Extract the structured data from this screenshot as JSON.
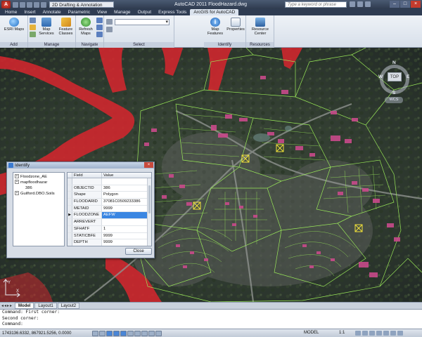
{
  "titlebar": {
    "app_letter": "A",
    "workspace": "2D Drafting & Annotation",
    "window_title": "AutoCAD 2011   FloodHazard.dwg",
    "search_placeholder": "Type a keyword or phrase"
  },
  "ribbon_tabs": [
    "Home",
    "Insert",
    "Annotate",
    "Parametric",
    "View",
    "Manage",
    "Output",
    "Express Tools",
    "ArcGIS for AutoCAD"
  ],
  "active_tab_index": 8,
  "ribbon": {
    "panels": {
      "add": "Add",
      "manage": "Manage",
      "navigate": "Navigate",
      "select": "Select",
      "identify": "Identify",
      "resources": "Resources"
    },
    "buttons": {
      "esri_maps": "ESRI Maps",
      "map_services": "Map Services",
      "feature_classes": "Feature Classes",
      "refresh_maps": "Refresh Maps",
      "map_features": "Map Features",
      "properties": "Properties",
      "resource_center": "Resource Center"
    }
  },
  "viewcube": {
    "north": "N",
    "south": "S",
    "east": "E",
    "west": "W",
    "top": "TOP",
    "wcs": "WCS"
  },
  "identify_dialog": {
    "title": "Identify",
    "tree": [
      {
        "label": "Floodzone_AE",
        "level": 0
      },
      {
        "label": "mapfloodhazar",
        "level": 0
      },
      {
        "label": "386",
        "level": 2
      },
      {
        "label": "Guilford.DBO.Soils",
        "level": 0
      }
    ],
    "columns": {
      "field": "Field",
      "value": "Value"
    },
    "rows": [
      {
        "field": "",
        "value": ""
      },
      {
        "field": "OBJECTID",
        "value": "386"
      },
      {
        "field": "Shape",
        "value": "Polygon"
      },
      {
        "field": "FLOODARID",
        "value": "37081C0509233386"
      },
      {
        "field": "METAID",
        "value": "9999"
      },
      {
        "field": "FLOODZONE",
        "value": "AEFW"
      },
      {
        "field": "ARREVERT",
        "value": ""
      },
      {
        "field": "SFHATF",
        "value": "1"
      },
      {
        "field": "STATICBFE",
        "value": "9999"
      },
      {
        "field": "DEPTH",
        "value": "9999"
      }
    ],
    "selected_row_index": 5,
    "close_label": "Close"
  },
  "layout_tabs": [
    "Model",
    "Layout1",
    "Layout2"
  ],
  "active_layout_index": 0,
  "command_lines": [
    "Command:  First corner:",
    "Second corner:",
    "Command:"
  ],
  "status": {
    "coordinates": "1743136.6332, 867921.5256, 0.0000",
    "model_label": "MODEL",
    "scale_label": "1:1"
  },
  "colors": {
    "flood_zone": "#d8262e",
    "parcel_lines": "#9ef05a",
    "buildings": "#c84a8a",
    "selection_highlight": "#3a86e2"
  }
}
